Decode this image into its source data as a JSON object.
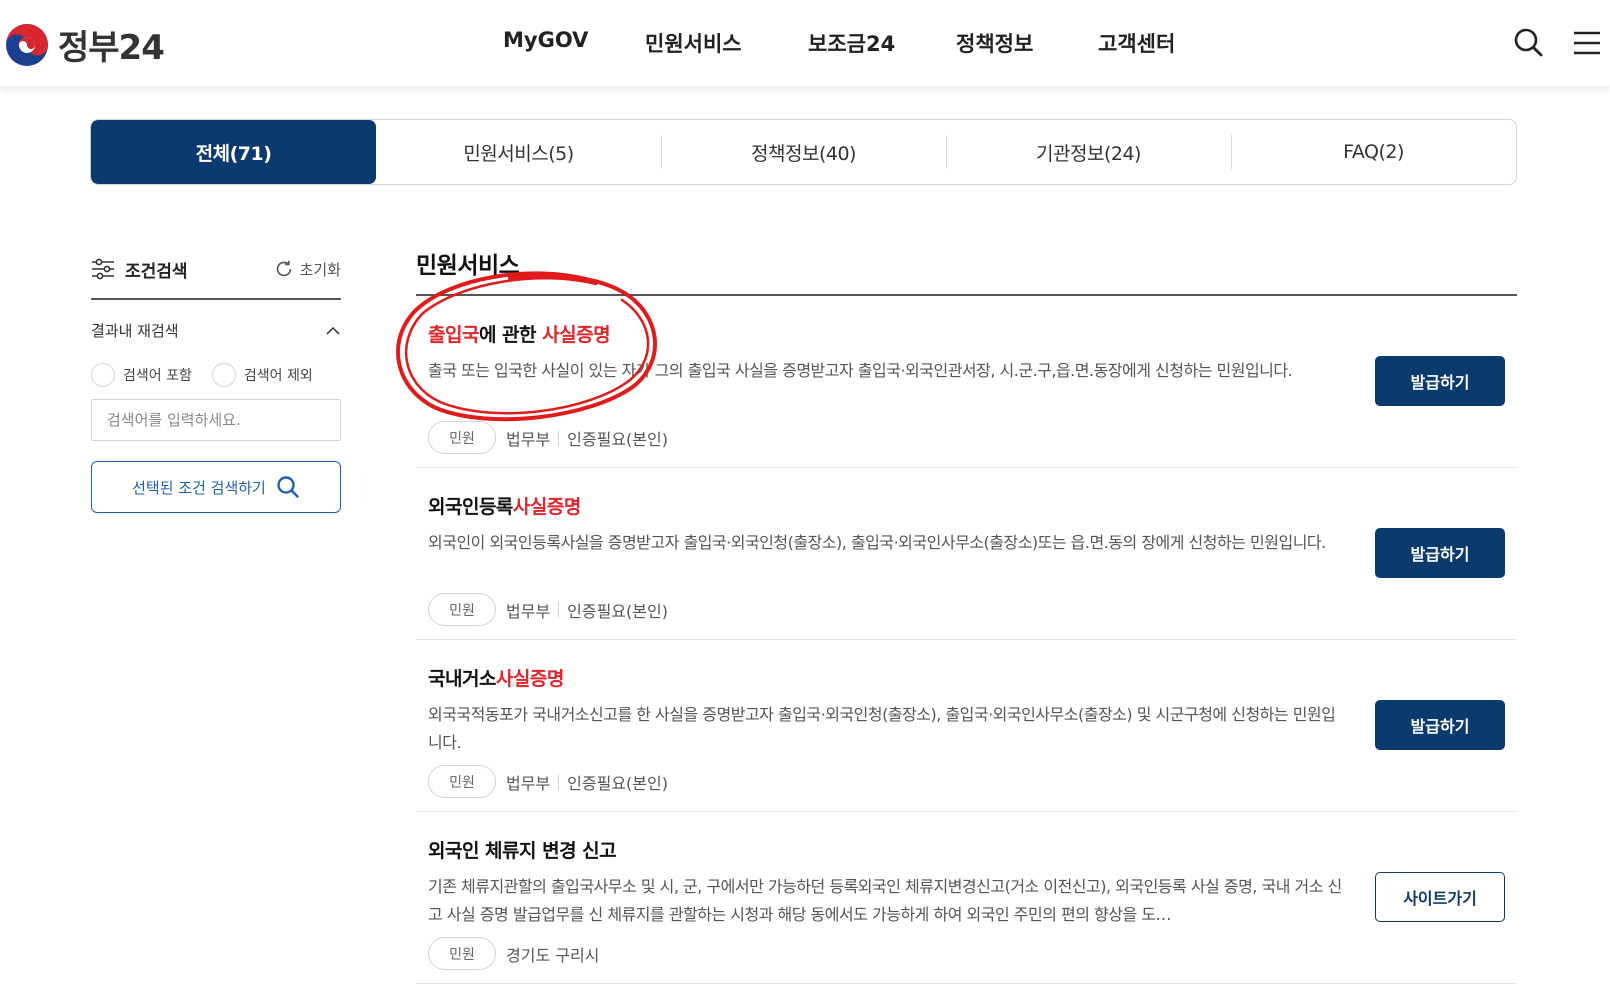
{
  "header": {
    "logo_text": "정부24",
    "nav": [
      "MyGOV",
      "민원서비스",
      "보조금24",
      "정책정보",
      "고객센터"
    ],
    "icons": [
      "search-icon",
      "menu-icon"
    ]
  },
  "tabs": [
    {
      "label": "전체(71)",
      "active": true
    },
    {
      "label": "민원서비스(5)",
      "active": false
    },
    {
      "label": "정책정보(40)",
      "active": false
    },
    {
      "label": "기관정보(24)",
      "active": false
    },
    {
      "label": "FAQ(2)",
      "active": false
    }
  ],
  "sidebar": {
    "title": "조건검색",
    "reset_label": "초기화",
    "section_label": "결과내 재검색",
    "radio_include": "검색어 포함",
    "radio_exclude": "검색어 제외",
    "input_placeholder": "검색어를 입력하세요.",
    "search_button": "선택된 조건 검색하기"
  },
  "results": {
    "section_title": "민원서비스",
    "items": [
      {
        "title_parts": [
          {
            "text": "출입국",
            "highlight": true
          },
          {
            "text": "에 관한 ",
            "highlight": false
          },
          {
            "text": "사실증명",
            "highlight": true
          }
        ],
        "description": "출국 또는 입국한 사실이 있는 자가 그의 출입국 사실을 증명받고자 출입국·외국인관서장, 시.군.구,읍.면.동장에게 신청하는 민원입니다.",
        "badge": "민원",
        "agency": "법무부",
        "auth": "인증필요(본인)",
        "button": "발급하기",
        "button_style": "primary"
      },
      {
        "title_parts": [
          {
            "text": "외국인등록",
            "highlight": false
          },
          {
            "text": "사실증명",
            "highlight": true
          }
        ],
        "description": "외국인이 외국인등록사실을 증명받고자 출입국·외국인청(출장소), 출입국·외국인사무소(출장소)또는 읍.면.동의 장에게 신청하는 민원입니다.",
        "badge": "민원",
        "agency": "법무부",
        "auth": "인증필요(본인)",
        "button": "발급하기",
        "button_style": "primary"
      },
      {
        "title_parts": [
          {
            "text": "국내거소",
            "highlight": false
          },
          {
            "text": "사실증명",
            "highlight": true
          }
        ],
        "description": "외국국적동포가 국내거소신고를 한 사실을 증명받고자 출입국·외국인청(출장소), 출입국·외국인사무소(출장소) 및 시군구청에 신청하는 민원입니다.",
        "badge": "민원",
        "agency": "법무부",
        "auth": "인증필요(본인)",
        "button": "발급하기",
        "button_style": "primary"
      },
      {
        "title_parts": [
          {
            "text": "외국인 체류지 변경 신고",
            "highlight": false
          }
        ],
        "description": "기존 체류지관할의 출입국사무소 및 시, 군, 구에서만 가능하던 등록외국인 체류지변경신고(거소 이전신고), 외국인등록 사실 증명, 국내 거소 신고 사실 증명 발급업무를 신 체류지를 관할하는 시청과 해당 동에서도 가능하게 하여 외국인 주민의 편의 향상을 도…",
        "badge": "민원",
        "agency": "경기도 구리시",
        "auth": "",
        "button": "사이트가기",
        "button_style": "outline"
      }
    ]
  },
  "colors": {
    "brand_navy": "#0b3a6e",
    "highlight_red": "#e0252b",
    "outline_blue": "#1d5fb0",
    "annotation_red": "#e01b1b"
  }
}
